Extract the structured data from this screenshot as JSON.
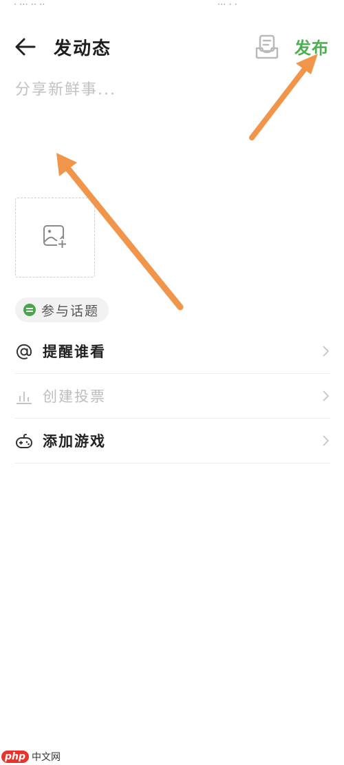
{
  "status_bar": {
    "left_text": "· ··· ·· ··",
    "right_text": "··· · ·"
  },
  "header": {
    "title": "发动态",
    "publish_label": "发布",
    "publish_color": "#4caf50",
    "back_icon": "arrow-left-icon",
    "draft_icon": "draft-box-icon"
  },
  "composer": {
    "placeholder": "分享新鲜事...",
    "value": ""
  },
  "image_upload": {
    "icon": "image-add-icon"
  },
  "topic": {
    "label": "参与话题",
    "icon": "topic-icon",
    "icon_color": "#49a64d"
  },
  "menu": {
    "items": [
      {
        "label": "提醒谁看",
        "icon": "at-icon",
        "enabled": true
      },
      {
        "label": "创建投票",
        "icon": "poll-chart-icon",
        "enabled": false
      },
      {
        "label": "添加游戏",
        "icon": "gamepad-icon",
        "enabled": true
      }
    ]
  },
  "annotation": {
    "arrow_color": "#f0954a"
  },
  "watermark": {
    "logo": "php",
    "text": "中文网"
  }
}
